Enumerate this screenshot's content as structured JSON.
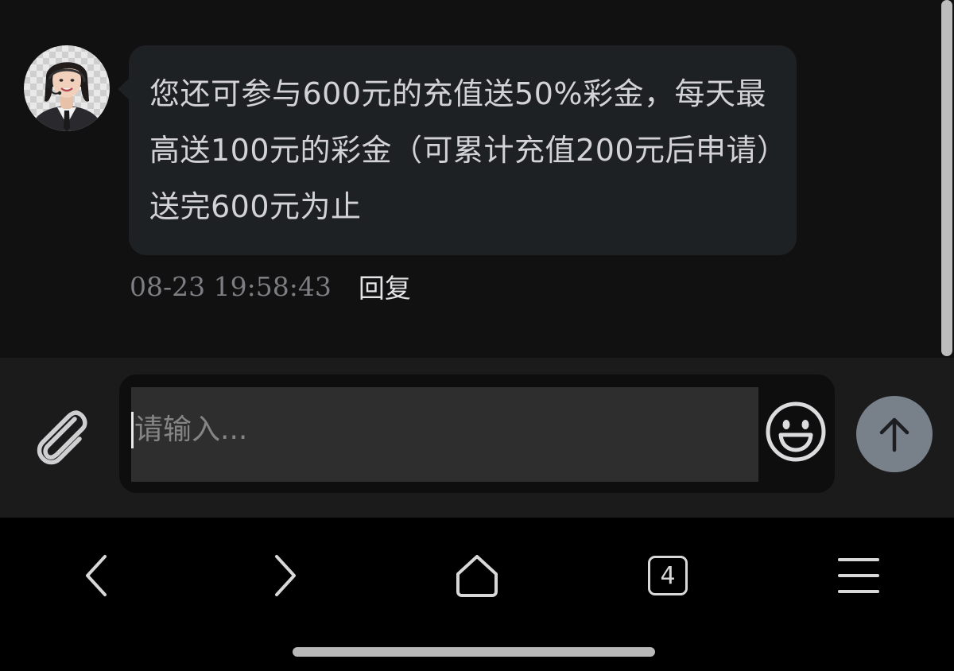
{
  "chat": {
    "message": {
      "text": "您还可参与600元的充值送50%彩金，每天最高送100元的彩金（可累计充值200元后申请）送完600元为止",
      "timestamp": "08-23 19:58:43",
      "reply_label": "回复"
    }
  },
  "composer": {
    "placeholder": "请输入...",
    "value": ""
  },
  "browser_nav": {
    "tab_count": "4"
  },
  "icons": {
    "avatar": "agent-avatar",
    "attach": "paperclip-icon",
    "emoji": "smiley-icon",
    "send": "arrow-up-icon",
    "back": "chevron-left-icon",
    "forward": "chevron-right-icon",
    "home": "home-icon",
    "tabs": "tabs-icon",
    "menu": "hamburger-menu-icon"
  },
  "colors": {
    "bubble": "#1e2124",
    "send_button": "#78808a",
    "chat_background": "#111112"
  }
}
